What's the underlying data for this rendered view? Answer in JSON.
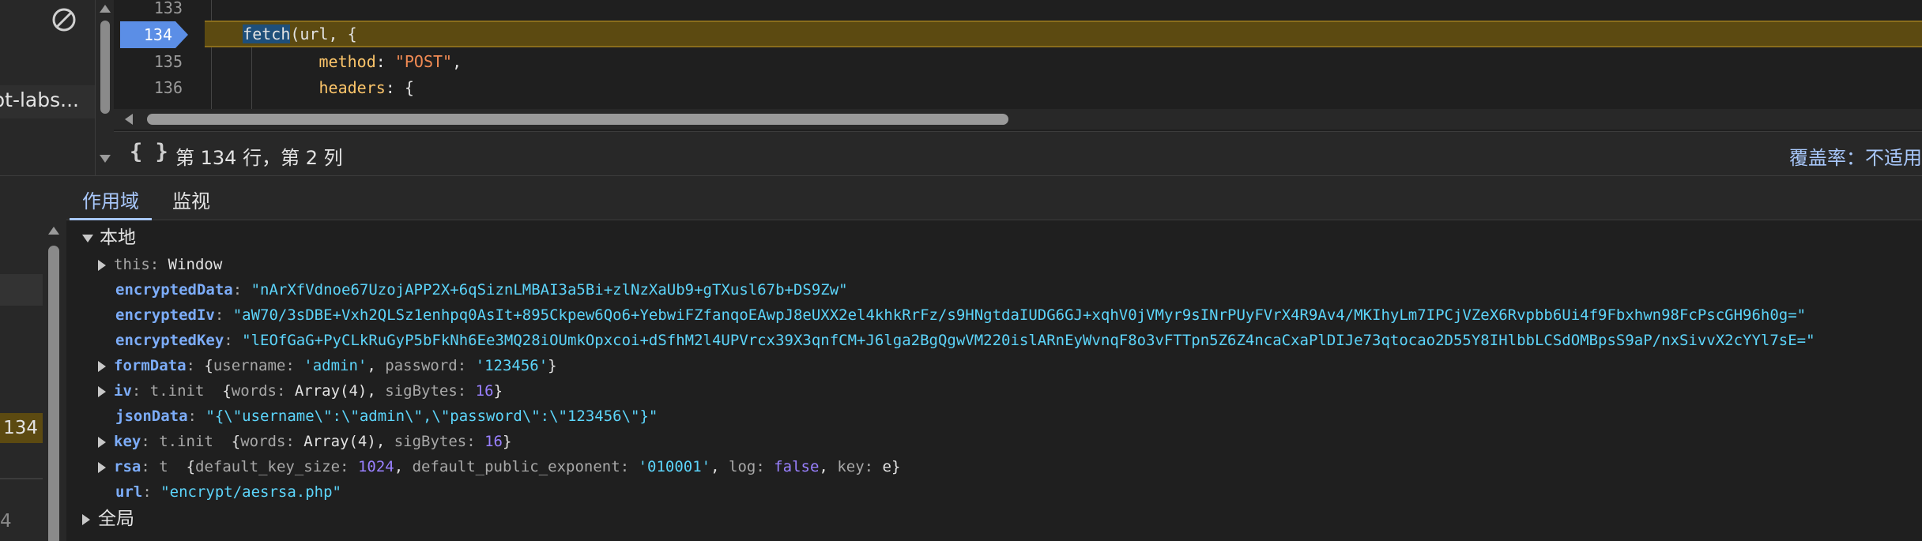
{
  "left_top": {
    "truncated_label": "pt-labs..."
  },
  "editor": {
    "lines": [
      {
        "number": "133",
        "active": false
      },
      {
        "number": "134",
        "active": true,
        "fn": "fetch",
        "rest": "(url, {"
      },
      {
        "number": "135",
        "active": false,
        "prop": "method",
        "sep": ": ",
        "value": "\"POST\"",
        "tail": ","
      },
      {
        "number": "136",
        "active": false,
        "prop": "headers",
        "sep": ": ",
        "tail": "{"
      }
    ]
  },
  "status_bar": {
    "cursor_position": "第 134 行，第 2 列",
    "coverage": "覆盖率：不适用"
  },
  "call_stack": {
    "active_line": "134",
    "partial_line": "4"
  },
  "scope": {
    "tabs": [
      {
        "label": "作用域",
        "active": true
      },
      {
        "label": "监视",
        "active": false
      }
    ],
    "local_header": "本地",
    "global_header": "全局",
    "this": {
      "key": "this",
      "value": "Window"
    },
    "encryptedData": {
      "key": "encryptedData",
      "value": "\"nArXfVdnoe67UzojAPP2X+6qSiznLMBAI3a5Bi+zlNzXaUb9+gTXusl67b+DS9Zw\""
    },
    "encryptedIv": {
      "key": "encryptedIv",
      "value": "\"aW70/3sDBE+Vxh2QLSz1enhpq0AsIt+895Ckpew6Qo6+YebwiFZfanqoEAwpJ8eUXX2el4khkRrFz/s9HNgtdaIUDG6GJ+xqhV0jVMyr9sINrPUyFVrX4R9Av4/MKIhyLm7IPCjVZeX6Rvpbb6Ui4f9Fbxhwn98FcPscGH96h0g=\""
    },
    "encryptedKey": {
      "key": "encryptedKey",
      "value": "\"lEOfGaG+PyCLkRuGyP5bFkNh6Ee3MQ28iOUmkOpxcoi+dSfhM2l4UPVrcx39X3qnfCM+J6lga2BgQgwVM220islARnEyWvnqF8o3vFTTpn5Z6Z4ncaCxaPlDIJe73qtocao2D55Y8IHlbbLCSdOMBpsS9aP/nxSivvX2cYYl7sE=\""
    },
    "formData": {
      "key": "formData",
      "open": "{",
      "k1": "username",
      "v1": "'admin'",
      "k2": "password",
      "v2": "'123456'",
      "close": "}"
    },
    "iv": {
      "key": "iv",
      "type": "t.init",
      "open": "{",
      "k1": "words",
      "v1": "Array(4)",
      "k2": "sigBytes",
      "v2": "16",
      "close": "}"
    },
    "jsonData": {
      "key": "jsonData",
      "value": "\"{\\\"username\\\":\\\"admin\\\",\\\"password\\\":\\\"123456\\\"}\""
    },
    "key": {
      "key": "key",
      "type": "t.init",
      "open": "{",
      "k1": "words",
      "v1": "Array(4)",
      "k2": "sigBytes",
      "v2": "16",
      "close": "}"
    },
    "rsa": {
      "key": "rsa",
      "type": "t",
      "open": "{",
      "k1": "default_key_size",
      "v1": "1024",
      "k2": "default_public_exponent",
      "v2": "'010001'",
      "k3": "log",
      "v3": "false",
      "k4": "key",
      "v4": "e",
      "close": "}"
    },
    "url": {
      "key": "url",
      "value": "\"encrypt/aesrsa.php\""
    }
  }
}
